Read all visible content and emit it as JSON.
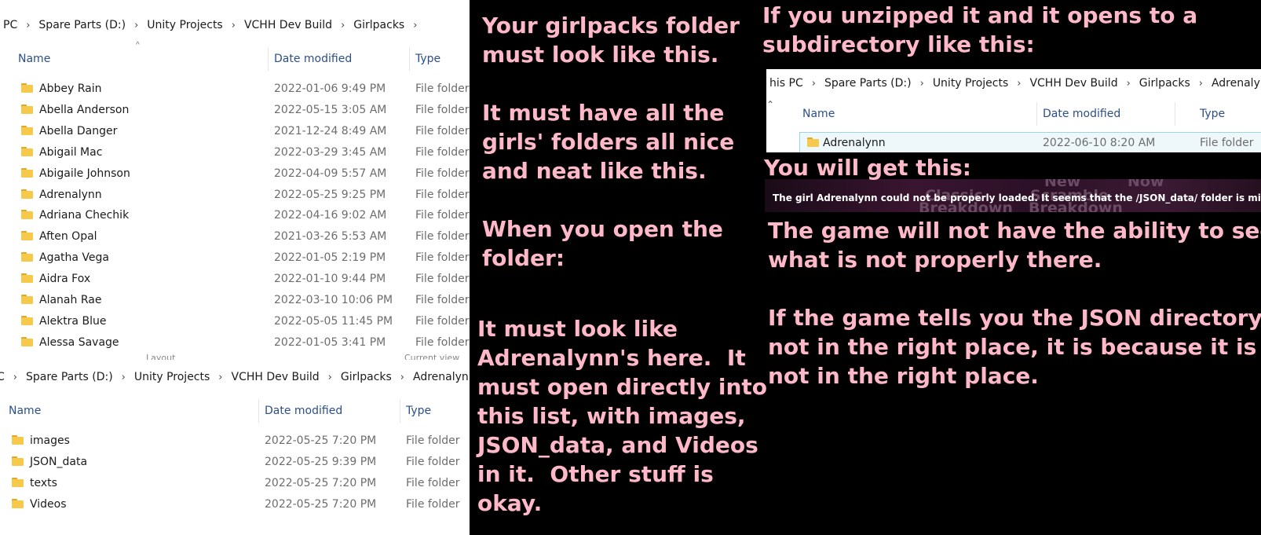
{
  "explorer1": {
    "breadcrumb": [
      "PC",
      "Spare Parts (D:)",
      "Unity Projects",
      "VCHH Dev Build",
      "Girlpacks"
    ],
    "columns": {
      "name": "Name",
      "date": "Date modified",
      "type": "Type"
    },
    "rows": [
      {
        "name": "Abbey Rain",
        "date": "2022-01-06 9:49 PM",
        "type": "File folder"
      },
      {
        "name": "Abella Anderson",
        "date": "2022-05-15 3:05 AM",
        "type": "File folder"
      },
      {
        "name": "Abella Danger",
        "date": "2021-12-24 8:49 AM",
        "type": "File folder"
      },
      {
        "name": "Abigail Mac",
        "date": "2022-03-29 3:45 AM",
        "type": "File folder"
      },
      {
        "name": "Abigaile Johnson",
        "date": "2022-04-09 5:57 AM",
        "type": "File folder"
      },
      {
        "name": "Adrenalynn",
        "date": "2022-05-25 9:25 PM",
        "type": "File folder"
      },
      {
        "name": "Adriana Chechik",
        "date": "2022-04-16 9:02 AM",
        "type": "File folder"
      },
      {
        "name": "Aften Opal",
        "date": "2021-03-26 5:53 AM",
        "type": "File folder"
      },
      {
        "name": "Agatha Vega",
        "date": "2022-01-05 2:19 PM",
        "type": "File folder"
      },
      {
        "name": "Aidra Fox",
        "date": "2022-01-10 9:44 PM",
        "type": "File folder"
      },
      {
        "name": "Alanah Rae",
        "date": "2022-03-10 10:06 PM",
        "type": "File folder"
      },
      {
        "name": "Alektra Blue",
        "date": "2022-05-05 11:45 PM",
        "type": "File folder"
      },
      {
        "name": "Alessa Savage",
        "date": "2022-01-05 3:41 PM",
        "type": "File folder"
      }
    ],
    "ribbon_labels": [
      "Layout",
      "Current view"
    ]
  },
  "explorer2": {
    "breadcrumb": [
      "C",
      "Spare Parts (D:)",
      "Unity Projects",
      "VCHH Dev Build",
      "Girlpacks",
      "Adrenalynn"
    ],
    "columns": {
      "name": "Name",
      "date": "Date modified",
      "type": "Type"
    },
    "rows": [
      {
        "name": "images",
        "date": "2022-05-25 7:20 PM",
        "type": "File folder"
      },
      {
        "name": "JSON_data",
        "date": "2022-05-25 9:39 PM",
        "type": "File folder"
      },
      {
        "name": "texts",
        "date": "2022-05-25 7:20 PM",
        "type": "File folder"
      },
      {
        "name": "Videos",
        "date": "2022-05-25 7:20 PM",
        "type": "File folder"
      }
    ]
  },
  "explorer3": {
    "breadcrumb": [
      "his PC",
      "Spare Parts (D:)",
      "Unity Projects",
      "VCHH Dev Build",
      "Girlpacks",
      "Adrenalynn"
    ],
    "columns": {
      "name": "Name",
      "date": "Date modified",
      "type": "Type"
    },
    "rows": [
      {
        "name": "Adrenalynn",
        "date": "2022-06-10 8:20 AM",
        "type": "File folder"
      }
    ]
  },
  "game_error": {
    "message": "The girl Adrenalynn could not be properly loaded. It seems that the /JSON_data/ folder is missing.",
    "background_text": [
      "New",
      "Now",
      "Classic",
      "Scramble",
      "Breakdown",
      "Breakdown"
    ]
  },
  "notes": {
    "middle_top": "Your girlpacks folder\nmust look like this.\n\nIt must have all the\ngirls' folders all nice\nand neat like this.\n\nWhen you open the\nfolder:",
    "middle_bottom": "It must look like\nAdrenalynn's here.  It\nmust open directly into\nthis list, with images,\nJSON_data, and Videos\nin it.  Other stuff is\nokay.",
    "right_top": "If you unzipped it and it opens to a\nsubdirectory like this:",
    "right_mid": "You will get this:",
    "right_bottom": "The game will not have the ability to see\nwhat is not properly there.\n\nIf the game tells you the JSON directory is\nnot in the right place, it is because it is\nnot in the right place."
  },
  "colors": {
    "note_text": "#ffb8c8",
    "folder": "#f7c94a",
    "header_text": "#2c4f8a"
  }
}
